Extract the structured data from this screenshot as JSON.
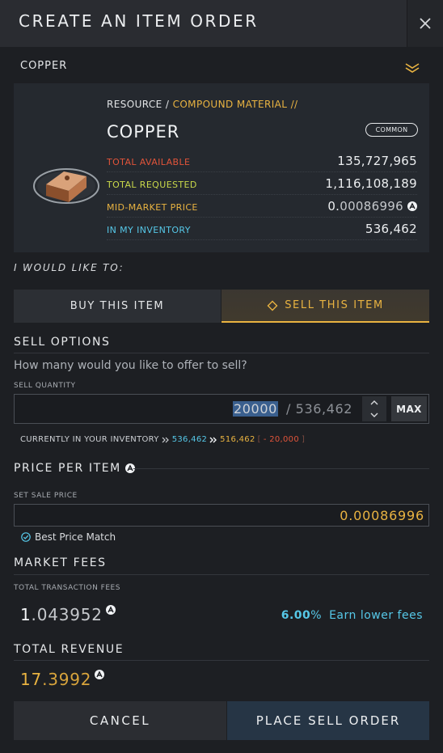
{
  "header": {
    "title": "CREATE AN ITEM ORDER"
  },
  "resource_select": {
    "value": "COPPER"
  },
  "item": {
    "breadcrumb_category": "RESOURCE",
    "breadcrumb_separator": "/",
    "breadcrumb_subcategory": "COMPOUND MATERIAL //",
    "name": "COPPER",
    "rarity": "COMMON",
    "stats": [
      {
        "label": "TOTAL AVAILABLE",
        "value": "135,727,965",
        "color": "#e1543a"
      },
      {
        "label": "TOTAL REQUESTED",
        "value": "1,116,108,189",
        "color": "#c9d84a"
      },
      {
        "label": "MID-MARKET PRICE",
        "value_major": "0.",
        "value_minor": "00086996",
        "color": "#e9b341"
      },
      {
        "label": "IN MY INVENTORY",
        "value": "536,462",
        "color": "#56c8e8"
      }
    ]
  },
  "intent": {
    "heading": "I WOULD LIKE TO:",
    "buy_label": "BUY THIS ITEM",
    "sell_label": "SELL THIS ITEM",
    "selected": "sell"
  },
  "sell_options": {
    "heading": "SELL OPTIONS",
    "question": "How many would you like to offer to sell?",
    "quantity_label": "SELL QUANTITY",
    "quantity_value": "20000",
    "quantity_max": "/ 536,462",
    "max_label": "MAX",
    "inventory_label": "CURRENTLY IN YOUR INVENTORY",
    "inventory_current": "536,462",
    "inventory_after": "516,462",
    "inventory_delta_open": "[",
    "inventory_delta": "- 20,000",
    "inventory_delta_close": "]"
  },
  "price": {
    "heading": "PRICE PER ITEM",
    "set_label": "SET SALE PRICE",
    "value": "0.00086996",
    "best_match_label": "Best Price Match",
    "best_match_checked": true
  },
  "fees": {
    "heading": "MARKET FEES",
    "label": "TOTAL TRANSACTION FEES",
    "value_major": "1",
    "value_minor": ".043952",
    "percent": "6.00",
    "percent_sign": "%",
    "lower_fees_link": "Earn lower fees"
  },
  "revenue": {
    "heading": "TOTAL REVENUE",
    "value_major": "17",
    "value_minor": ".3992"
  },
  "actions": {
    "cancel_label": "CANCEL",
    "place_label": "PLACE SELL ORDER"
  },
  "colors": {
    "accent_gold": "#e9b341",
    "accent_cyan": "#56c8e8",
    "danger_red": "#e1543a",
    "primary_button": "#263545"
  },
  "icons": [
    "close-icon",
    "chevron-down-icon",
    "copper-bar-icon",
    "aurum-currency-icon",
    "diamond-icon",
    "arrow-up-icon",
    "arrow-down-icon",
    "double-chevron-right-icon",
    "check-circle-icon"
  ]
}
